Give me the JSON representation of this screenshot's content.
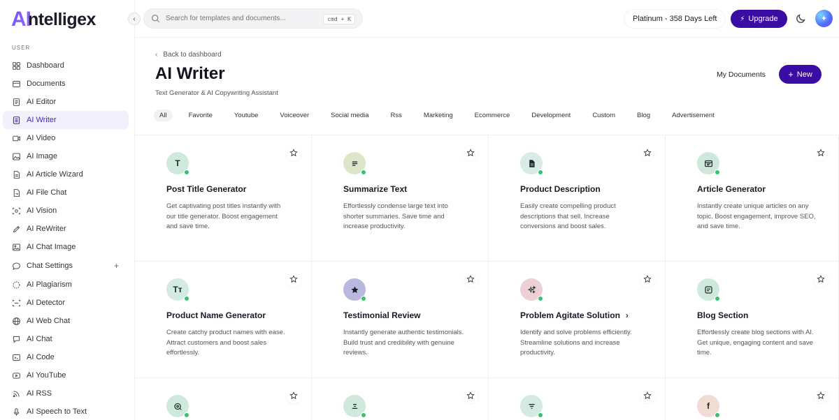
{
  "logo": {
    "ai": "AI",
    "rest": "ntelligex"
  },
  "sidebar": {
    "section_label": "USER",
    "items": [
      {
        "label": "Dashboard",
        "icon": "grid-icon"
      },
      {
        "label": "Documents",
        "icon": "folder-icon"
      },
      {
        "label": "AI Editor",
        "icon": "editor-icon"
      },
      {
        "label": "AI Writer",
        "icon": "document-icon",
        "active": true
      },
      {
        "label": "AI Video",
        "icon": "video-icon"
      },
      {
        "label": "AI Image",
        "icon": "image-icon"
      },
      {
        "label": "AI Article Wizard",
        "icon": "wizard-icon"
      },
      {
        "label": "AI File Chat",
        "icon": "file-chat-icon"
      },
      {
        "label": "AI Vision",
        "icon": "vision-icon"
      },
      {
        "label": "AI ReWriter",
        "icon": "pen-icon"
      },
      {
        "label": "AI Chat Image",
        "icon": "chat-image-icon"
      },
      {
        "label": "Chat Settings",
        "icon": "chat-bubble-icon",
        "plus": "+"
      },
      {
        "label": "AI Plagiarism",
        "icon": "plagiarism-icon"
      },
      {
        "label": "AI Detector",
        "icon": "scan-icon"
      },
      {
        "label": "AI Web Chat",
        "icon": "globe-icon"
      },
      {
        "label": "AI Chat",
        "icon": "chat-icon"
      },
      {
        "label": "AI Code",
        "icon": "terminal-icon"
      },
      {
        "label": "AI YouTube",
        "icon": "youtube-icon"
      },
      {
        "label": "AI RSS",
        "icon": "rss-icon"
      },
      {
        "label": "AI Speech to Text",
        "icon": "mic-icon"
      }
    ]
  },
  "search": {
    "placeholder": "Search for templates and documents...",
    "shortcut": "cmd + K"
  },
  "header": {
    "plan": "Platinum - 358 Days Left",
    "upgrade_label": "Upgrade",
    "back_label": "Back to dashboard",
    "title": "AI Writer",
    "subtitle": "Text Generator & AI Copywriting Assistant",
    "my_documents_label": "My Documents",
    "new_label": "New"
  },
  "filters": [
    "All",
    "Favorite",
    "Youtube",
    "Voiceover",
    "Social media",
    "Rss",
    "Marketing",
    "Ecommerce",
    "Development",
    "Custom",
    "Blog",
    "Advertisement"
  ],
  "cards": [
    {
      "title": "Post Title Generator",
      "desc": "Get captivating post titles instantly with our title generator. Boost engagement and save time.",
      "icon_text": "T",
      "icon": "title-icon",
      "color": "#cfe9dd"
    },
    {
      "title": "Summarize Text",
      "desc": "Effortlessly condense large text into shorter summaries. Save time and increase productivity.",
      "icon_text": "",
      "icon": "lines-icon",
      "color": "#dde6c9"
    },
    {
      "title": "Product Description",
      "desc": "Easily create compelling product descriptions that sell. Increase conversions and boost sales.",
      "icon_text": "",
      "icon": "file-icon",
      "color": "#d8ebe6"
    },
    {
      "title": "Article Generator",
      "desc": "Instantly create unique articles on any topic. Boost engagement, improve SEO, and save time.",
      "icon_text": "",
      "icon": "browser-icon",
      "color": "#cfe8dc"
    },
    {
      "title": "Product Name Generator",
      "desc": "Create catchy product names with ease. Attract customers and boost sales effortlessly.",
      "icon_text": "Tт",
      "icon": "type-icon",
      "color": "#d3ebe3"
    },
    {
      "title": "Testimonial Review",
      "desc": "Instantly generate authentic testimonials. Build trust and credibility with genuine reviews.",
      "icon_text": "",
      "icon": "star-filled-icon",
      "color": "#b9b9e0"
    },
    {
      "title": "Problem Agitate Solution",
      "desc": "Identify and solve problems efficiently. Streamline solutions and increase productivity.",
      "icon_text": "",
      "icon": "sparkle-icon",
      "color": "#ecd0d6",
      "arrow": "›"
    },
    {
      "title": "Blog Section",
      "desc": "Effortlessly create blog sections with AI. Get unique, engaging content and save time.",
      "icon_text": "",
      "icon": "blog-icon",
      "color": "#cfe9dd"
    },
    {
      "title": "",
      "desc": "",
      "icon_text": "",
      "icon": "target-icon",
      "color": "#cfe9dd"
    },
    {
      "title": "",
      "desc": "",
      "icon_text": "",
      "icon": "align-icon",
      "color": "#cfe9dd"
    },
    {
      "title": "",
      "desc": "",
      "icon_text": "",
      "icon": "filter-icon",
      "color": "#d3ebe3"
    },
    {
      "title": "",
      "desc": "",
      "icon_text": "f",
      "icon": "facebook-icon",
      "color": "#f1dbd2"
    }
  ]
}
